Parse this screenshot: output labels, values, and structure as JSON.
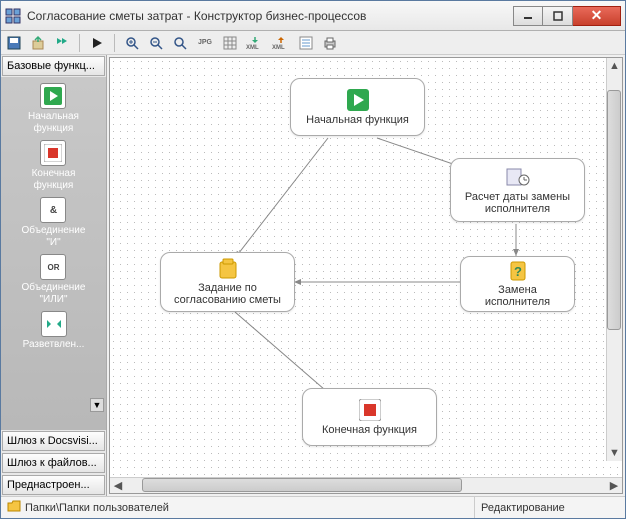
{
  "window": {
    "title": "Согласование сметы затрат - Конструктор бизнес-процессов"
  },
  "sidebar": {
    "header": "Базовые функц...",
    "items": [
      {
        "label": "Начальная\nфункция",
        "kind": "start"
      },
      {
        "label": "Конечная\nфункция",
        "kind": "end"
      },
      {
        "label": "Объединение\n\"И\"",
        "kind": "and"
      },
      {
        "label": "Объединение\n\"ИЛИ\"",
        "kind": "or"
      },
      {
        "label": "Разветвлен...",
        "kind": "branch"
      }
    ],
    "footer_buttons": [
      "Шлюз к Docsvisi...",
      "Шлюз к файлов...",
      "Преднастроен..."
    ]
  },
  "nodes": {
    "start": {
      "label": "Начальная функция"
    },
    "calc": {
      "label": "Расчет даты замены исполнителя"
    },
    "task": {
      "label": "Задание по согласованию сметы"
    },
    "replace": {
      "label": "Замена исполнителя"
    },
    "end": {
      "label": "Конечная функция"
    }
  },
  "status": {
    "path": "Папки\\Папки пользователей",
    "mode": "Редактирование"
  },
  "colors": {
    "start_icon": "#2fa84f",
    "end_icon": "#d9362a",
    "task_icon": "#f5c542",
    "help_icon": "#f5c542"
  }
}
